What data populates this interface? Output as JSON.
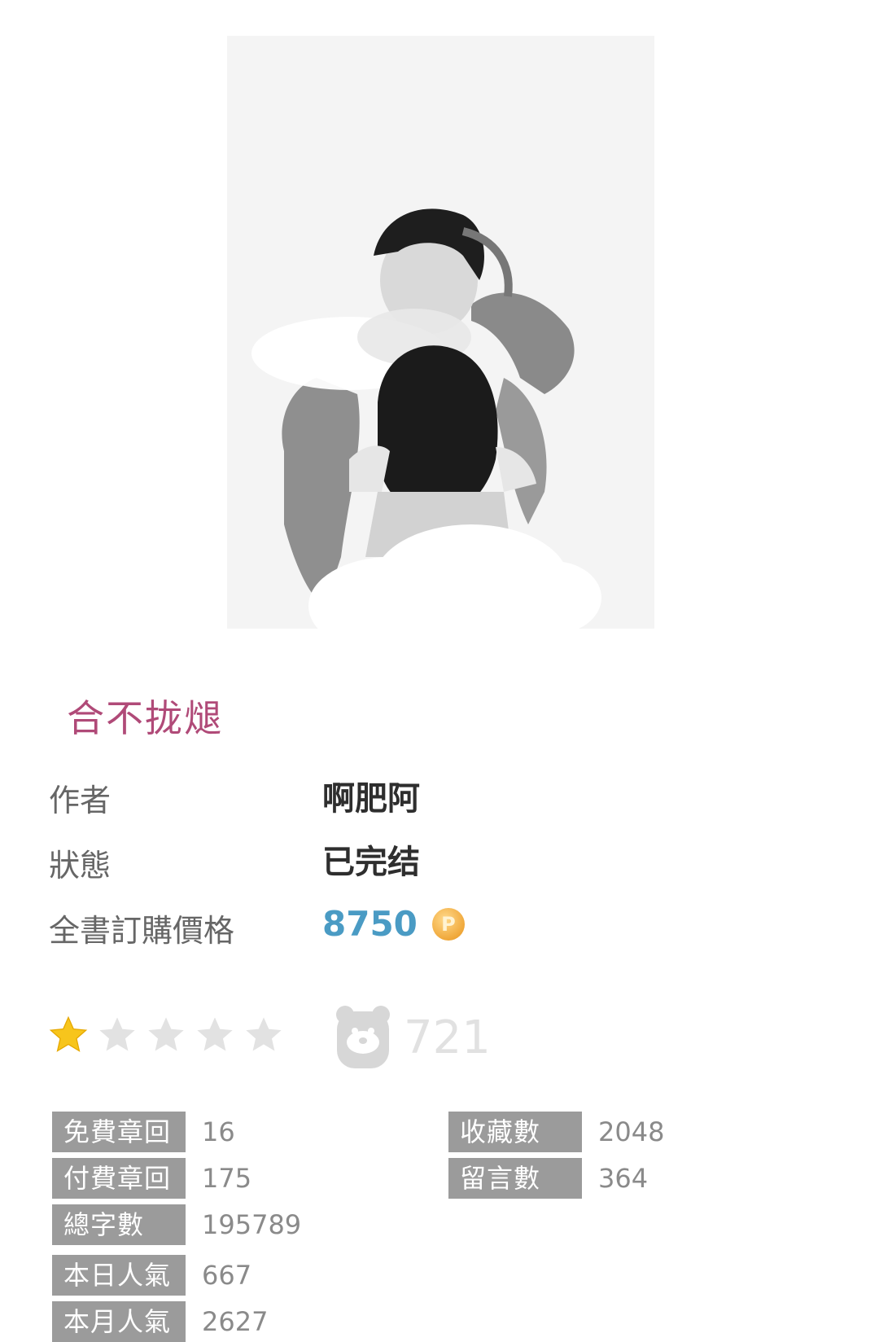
{
  "book": {
    "title": "合不拢煺",
    "author_label": "作者",
    "author": "啊肥阿",
    "status_label": "狀態",
    "status": "已完结",
    "price_label": "全書訂購價格",
    "price": "8750",
    "coin_symbol": "P"
  },
  "rating": {
    "stars_filled": 1,
    "stars_total": 5,
    "star_color_filled": "#f7c51c",
    "star_color_empty": "#e2e2e2",
    "popularity_icon": "bear-face-icon",
    "popularity_count": "721"
  },
  "stats": {
    "left": [
      {
        "label": "免費章回",
        "value": "16"
      },
      {
        "label": "付費章回",
        "value": "175"
      },
      {
        "label": "總字數",
        "value": "195789"
      },
      {
        "label": "本日人氣",
        "value": "667"
      },
      {
        "label": "本月人氣",
        "value": "2627"
      }
    ],
    "right": [
      {
        "label": "收藏數",
        "value": "2048"
      },
      {
        "label": "留言數",
        "value": "364"
      }
    ]
  },
  "colors": {
    "title": "#b04a78",
    "price": "#4a9bc4",
    "label_bg": "#9b9b9b"
  }
}
